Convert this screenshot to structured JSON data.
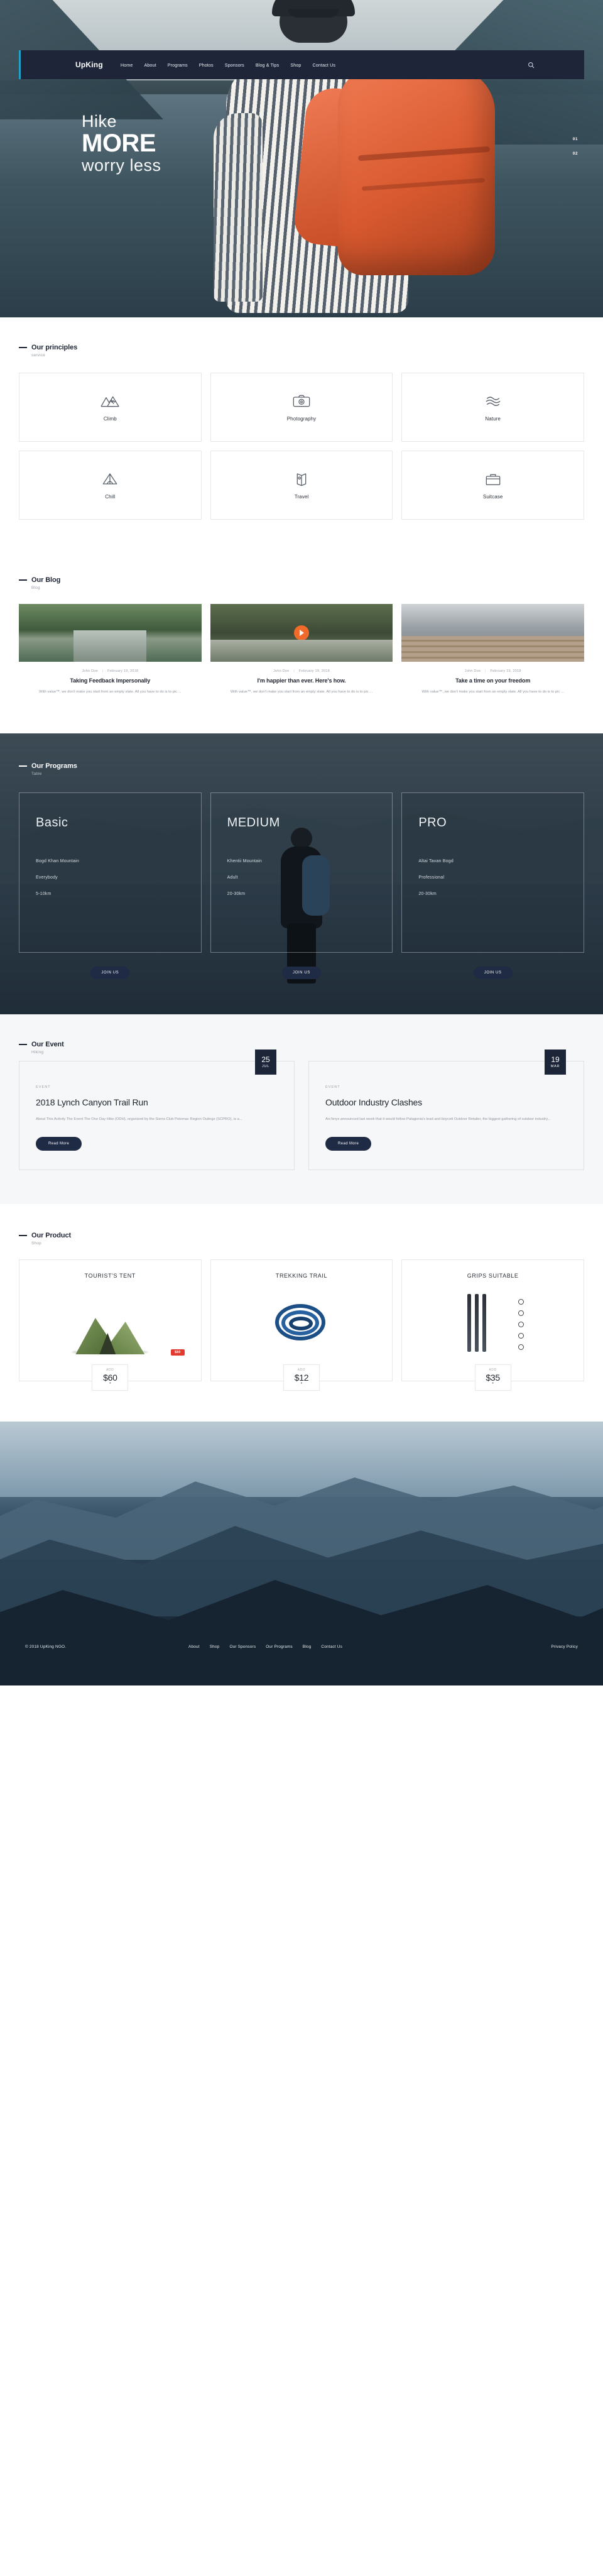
{
  "nav": {
    "brand": "UpKing",
    "links": [
      "Home",
      "About",
      "Programs",
      "Photos",
      "Sponsors",
      "Blog & Tips",
      "Shop",
      "Contact Us"
    ],
    "search_icon": "search-icon"
  },
  "hero": {
    "line1": "Hike",
    "line2": "MORE",
    "line3": "worry less",
    "pager": [
      "01",
      "02"
    ]
  },
  "principles": {
    "title": "Our principles",
    "subtitle": "service",
    "items": [
      {
        "label": "Climb",
        "icon": "mountains-icon"
      },
      {
        "label": "Photography",
        "icon": "camera-icon"
      },
      {
        "label": "Nature",
        "icon": "wave-nature-icon"
      },
      {
        "label": "Chill",
        "icon": "tent-chill-icon"
      },
      {
        "label": "Travel",
        "icon": "map-travel-icon"
      },
      {
        "label": "Suitcase",
        "icon": "suitcase-icon"
      }
    ]
  },
  "blog": {
    "title": "Our Blog",
    "subtitle": "Blog",
    "posts": [
      {
        "author": "John Doe",
        "date": "February 19, 2018",
        "title": "Taking Feedback Impersonally",
        "excerpt": "With value™, we don't make you start from an empty slate. All you have to do is to pic ..."
      },
      {
        "author": "John Doe",
        "date": "February 19, 2018",
        "title": "I'm happier than ever. Here's how.",
        "excerpt": "With value™, we don't make you start from an empty slate. All you have to do is to pic ..."
      },
      {
        "author": "John Doe",
        "date": "February 19, 2018",
        "title": "Take a time on your freedom",
        "excerpt": "With value™, we don't make you start from an empty slate. All you have to do is to pic ..."
      }
    ]
  },
  "programs": {
    "title": "Our Programs",
    "subtitle": "Table",
    "join_label": "JOIN US",
    "cards": [
      {
        "name": "Basic",
        "location": "Bogd Khan Mountain",
        "audience": "Everybody",
        "distance": "5-10km"
      },
      {
        "name": "MEDIUM",
        "location": "Khentii Mountain",
        "audience": "Adult",
        "distance": "20-30km"
      },
      {
        "name": "PRO",
        "location": "Altai Tavan Bogd",
        "audience": "Professional",
        "distance": "20-30km"
      }
    ]
  },
  "events": {
    "title": "Our Event",
    "subtitle": "Hiking",
    "read_more": "Read More",
    "items": [
      {
        "day": "25",
        "month": "JUL",
        "kicker": "EVENT",
        "title": "2018 Lynch Canyon Trail Run",
        "desc": "About This Activity The Event The One Day Hike (ODH), organized by the Sierra Club Potomac Region Outings (SCPRO), is a..."
      },
      {
        "day": "19",
        "month": "MAR",
        "kicker": "EVENT",
        "title": "Outdoor Industry Clashes",
        "desc": "Arc'teryx announced last week that it would follow Patagonia's lead and boycott Outdoor Retailer, the biggest gathering of outdoor industry..."
      }
    ]
  },
  "products": {
    "title": "Our Product",
    "subtitle": "Shop",
    "add_label": "ADD",
    "items": [
      {
        "name": "TOURIST'S TENT",
        "price": "$60",
        "badge": "$80"
      },
      {
        "name": "TREKKING TRAIL",
        "price": "$12",
        "badge": ""
      },
      {
        "name": "GRIPS SUITABLE",
        "price": "$35",
        "badge": ""
      }
    ]
  },
  "footer": {
    "copyright": "© 2018 UpKing NGO.",
    "links": [
      "About",
      "Shop",
      "Our Sponsors",
      "Our Programs",
      "Blog",
      "Contact Us"
    ],
    "privacy": "Privacy Policy"
  }
}
